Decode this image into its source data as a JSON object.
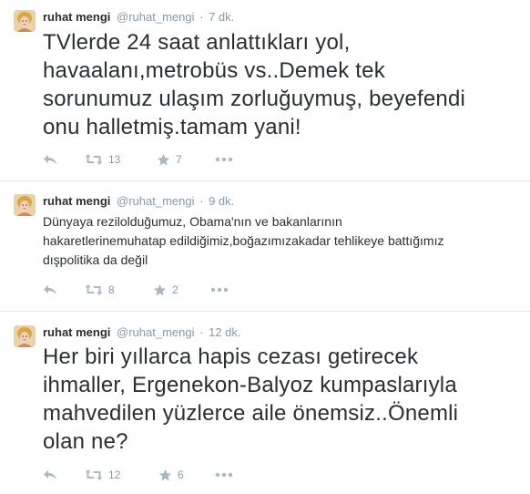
{
  "colors": {
    "text": "#292f33",
    "meta": "#8899a6",
    "icon": "#aab8c2",
    "divider": "#e1e8ed"
  },
  "tweets": [
    {
      "fullname": "ruhat mengi",
      "username": "@ruhat_mengi",
      "separator": "·",
      "time": "7 dk.",
      "text": "TVlerde 24 saat anlattıkları yol,\nhavaalanı,metrobüs vs..Demek tek\nsorunumuz ulaşım zorluğuymuş, beyefendi\nonu halletmiş.tamam yani!",
      "retweet_count": "13",
      "favorite_count": "7",
      "icons": [
        "reply-icon",
        "retweet-icon",
        "favorite-star-icon",
        "more-icon"
      ]
    },
    {
      "fullname": "ruhat mengi",
      "username": "@ruhat_mengi",
      "separator": "·",
      "time": "9 dk.",
      "text": "Dünyaya rezilolduğumuz, Obama'nın ve bakanlarının\nhakaretlerinemuhatap edildiğimiz,boğazımızakadar tehlikeye battığımız\ndışpolitika da değil",
      "retweet_count": "8",
      "favorite_count": "2",
      "icons": [
        "reply-icon",
        "retweet-icon",
        "favorite-star-icon",
        "more-icon"
      ]
    },
    {
      "fullname": "ruhat mengi",
      "username": "@ruhat_mengi",
      "separator": "·",
      "time": "12 dk.",
      "text": "Her biri yıllarca hapis cezası getirecek\nihmaller, Ergenekon-Balyoz kumpaslarıyla\nmahvedilen yüzlerce aile önemsiz..Önemli\nolan ne?",
      "retweet_count": "12",
      "favorite_count": "6",
      "icons": [
        "reply-icon",
        "retweet-icon",
        "favorite-star-icon",
        "more-icon"
      ]
    }
  ]
}
